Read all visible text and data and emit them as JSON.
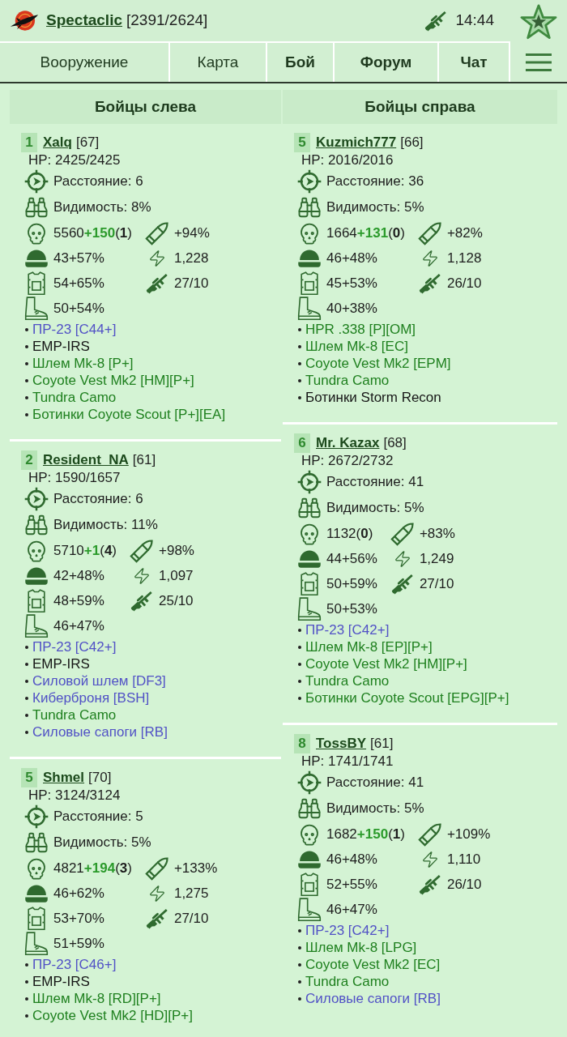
{
  "header": {
    "username": "Spectaclic",
    "hp": "[2391/2624]",
    "time": "14:44"
  },
  "tabs": [
    {
      "label": "Вооружение",
      "highlighted": false
    },
    {
      "label": "Карта",
      "highlighted": false
    },
    {
      "label": "Бой",
      "highlighted": true
    },
    {
      "label": "Форум",
      "highlighted": true
    },
    {
      "label": "Чат",
      "highlighted": true
    }
  ],
  "columns": [
    {
      "title": "Бойцы слева",
      "fighters": [
        {
          "number": "1",
          "name": "Xalq",
          "level": "[67]",
          "hp": "HP: 2425/2425",
          "distance": "Расстояние: 6",
          "visibility": "Видимость: 8%",
          "kills": {
            "base": "5560",
            "bonus": "+150",
            "count": "(**1**)"
          },
          "accuracy": "+94%",
          "helmet": "43+57%",
          "energy": "1,228",
          "armor": "54+65%",
          "weapon": "27/10",
          "boots": "50+54%",
          "equipment": [
            {
              "text": "ПР-23 [C44+]",
              "color": "#5151c6"
            },
            {
              "text": "EMP-IRS",
              "color": "#151515"
            },
            {
              "text": "Шлем Mk-8 [P+]",
              "color": "#1f801f"
            },
            {
              "text": "Coyote Vest Mk2 [HM][P+]",
              "color": "#1f801f"
            },
            {
              "text": "Tundra Camo",
              "color": "#1f801f"
            },
            {
              "text": "Ботинки Coyote Scout [P+][EA]",
              "color": "#1f801f"
            }
          ]
        },
        {
          "number": "2",
          "name": "Resident_NA",
          "level": "[61]",
          "hp": "HP: 1590/1657",
          "distance": "Расстояние: 6",
          "visibility": "Видимость: 11%",
          "kills": {
            "base": "5710",
            "bonus": "+1",
            "count": "(**4**)"
          },
          "accuracy": "+98%",
          "helmet": "42+48%",
          "energy": "1,097",
          "armor": "48+59%",
          "weapon": "25/10",
          "boots": "46+47%",
          "equipment": [
            {
              "text": "ПР-23 [C42+]",
              "color": "#5151c6"
            },
            {
              "text": "EMP-IRS",
              "color": "#151515"
            },
            {
              "text": "Силовой шлем [DF3]",
              "color": "#5151c6"
            },
            {
              "text": "Киберброня [BSH]",
              "color": "#5151c6"
            },
            {
              "text": "Tundra Camo",
              "color": "#1f801f"
            },
            {
              "text": "Силовые сапоги [RB]",
              "color": "#5151c6"
            }
          ]
        },
        {
          "number": "5",
          "name": "Shmel",
          "level": "[70]",
          "hp": "HP: 3124/3124",
          "distance": "Расстояние: 5",
          "visibility": "Видимость: 5%",
          "kills": {
            "base": "4821",
            "bonus": "+194",
            "count": "(**3**)"
          },
          "accuracy": "+133%",
          "helmet": "46+62%",
          "energy": "1,275",
          "armor": "53+70%",
          "weapon": "27/10",
          "boots": "51+59%",
          "equipment": [
            {
              "text": "ПР-23 [C46+]",
              "color": "#5151c6"
            },
            {
              "text": "EMP-IRS",
              "color": "#151515"
            },
            {
              "text": "Шлем Mk-8 [RD][P+]",
              "color": "#1f801f"
            },
            {
              "text": "Coyote Vest Mk2 [HD][P+]",
              "color": "#1f801f"
            }
          ]
        }
      ]
    },
    {
      "title": "Бойцы справа",
      "fighters": [
        {
          "number": "5",
          "name": "Kuzmich777",
          "level": "[66]",
          "hp": "HP: 2016/2016",
          "distance": "Расстояние: 36",
          "visibility": "Видимость: 5%",
          "kills": {
            "base": "1664",
            "bonus": "+131",
            "count": "(**0**)"
          },
          "accuracy": "+82%",
          "helmet": "46+48%",
          "energy": "1,128",
          "armor": "45+53%",
          "weapon": "26/10",
          "boots": "40+38%",
          "equipment": [
            {
              "text": "HPR .338 [P][OM]",
              "color": "#1f801f"
            },
            {
              "text": "Шлем Mk-8 [EC]",
              "color": "#1f801f"
            },
            {
              "text": "Coyote Vest Mk2 [EPM]",
              "color": "#1f801f"
            },
            {
              "text": "Tundra Camo",
              "color": "#1f801f"
            },
            {
              "text": "Ботинки Storm Recon",
              "color": "#151515"
            }
          ]
        },
        {
          "number": "6",
          "name": "Mr. Kazax",
          "level": "[68]",
          "hp": "HP: 2672/2732",
          "distance": "Расстояние: 41",
          "visibility": "Видимость: 5%",
          "kills": {
            "base": "1132",
            "count": "(**0**)"
          },
          "accuracy": "+83%",
          "helmet": "44+56%",
          "energy": "1,249",
          "armor": "50+59%",
          "weapon": "27/10",
          "boots": "50+53%",
          "equipment": [
            {
              "text": "ПР-23 [C42+]",
              "color": "#5151c6"
            },
            {
              "text": "Шлем Mk-8 [EP][P+]",
              "color": "#1f801f"
            },
            {
              "text": "Coyote Vest Mk2 [HM][P+]",
              "color": "#1f801f"
            },
            {
              "text": "Tundra Camo",
              "color": "#1f801f"
            },
            {
              "text": "Ботинки Coyote Scout [EPG][P+]",
              "color": "#1f801f"
            }
          ]
        },
        {
          "number": "8",
          "name": "TossBY",
          "level": "[61]",
          "hp": "HP: 1741/1741",
          "distance": "Расстояние: 41",
          "visibility": "Видимость: 5%",
          "kills": {
            "base": "1682",
            "bonus": "+150",
            "count": "(**1**)"
          },
          "accuracy": "+109%",
          "helmet": "46+48%",
          "energy": "1,110",
          "armor": "52+55%",
          "weapon": "26/10",
          "boots": "46+47%",
          "equipment": [
            {
              "text": "ПР-23 [C42+]",
              "color": "#5151c6"
            },
            {
              "text": "Шлем Mk-8 [LPG]",
              "color": "#1f801f"
            },
            {
              "text": "Coyote Vest Mk2 [EC]",
              "color": "#1f801f"
            },
            {
              "text": "Tundra Camo",
              "color": "#1f801f"
            },
            {
              "text": "Силовые сапоги [RB]",
              "color": "#5151c6"
            }
          ]
        }
      ]
    }
  ]
}
